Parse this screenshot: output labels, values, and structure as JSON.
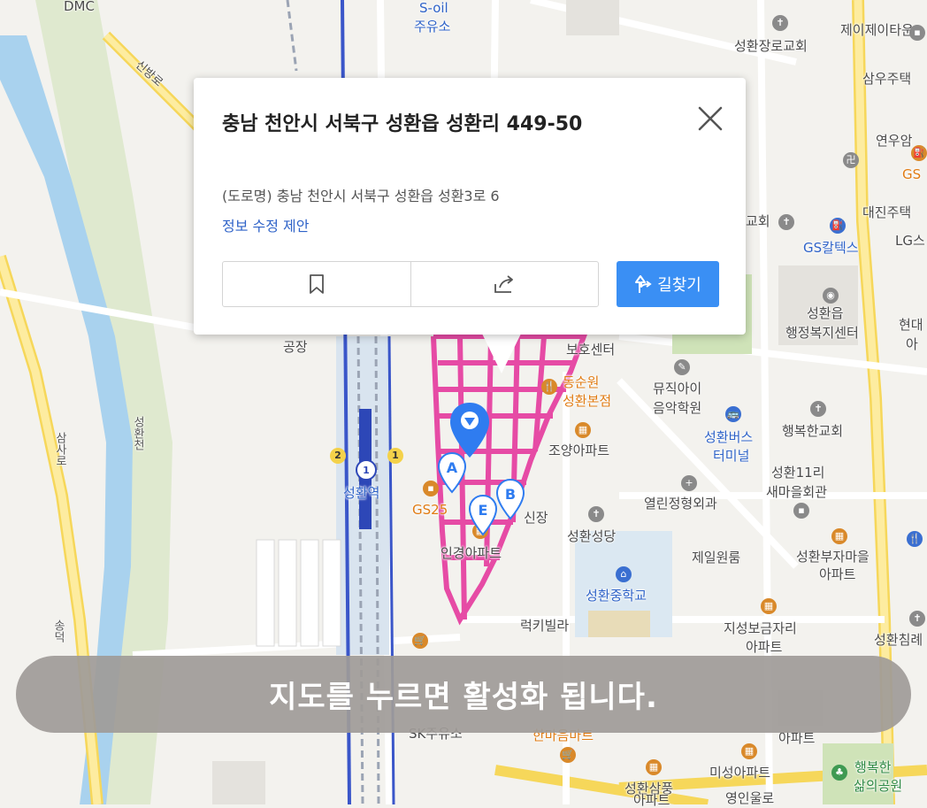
{
  "popup": {
    "title": "충남 천안시 서북구 성환읍 성환리 449-50",
    "road_address": "(도로명) 충남 천안시 서북구 성환읍 성환3로 6",
    "edit_link": "정보 수정 제안",
    "route_label": "길찾기"
  },
  "overlay": {
    "message": "지도를 누르면 활성화 됩니다."
  },
  "map": {
    "labels": [
      {
        "text": "DMC"
      },
      {
        "text": "S-oil"
      },
      {
        "text": "주유소"
      },
      {
        "text": "성환장로교회"
      },
      {
        "text": "제이제이타운"
      },
      {
        "text": "삼우주택"
      },
      {
        "text": "연우암"
      },
      {
        "text": "GS"
      },
      {
        "text": "교회"
      },
      {
        "text": "대진주택"
      },
      {
        "text": "GS칼텍스"
      },
      {
        "text": "LG스"
      },
      {
        "text": "성환읍"
      },
      {
        "text": "행정복지센터"
      },
      {
        "text": "현대"
      },
      {
        "text": "아"
      },
      {
        "text": "공장"
      },
      {
        "text": "보호센터"
      },
      {
        "text": "동순원"
      },
      {
        "text": "성환본점"
      },
      {
        "text": "뮤직아이"
      },
      {
        "text": "음악학원"
      },
      {
        "text": "성환버스"
      },
      {
        "text": "터미널"
      },
      {
        "text": "행복한교회"
      },
      {
        "text": "조양아파트"
      },
      {
        "text": "성환11리"
      },
      {
        "text": "새마을회관"
      },
      {
        "text": "성환역"
      },
      {
        "text": "GS25"
      },
      {
        "text": "신장"
      },
      {
        "text": "열린정형외과"
      },
      {
        "text": "성환성당"
      },
      {
        "text": "제일원룸"
      },
      {
        "text": "성환부자마을"
      },
      {
        "text": "아파트"
      },
      {
        "text": "인경아파트"
      },
      {
        "text": "성환중학교"
      },
      {
        "text": "럭키빌라"
      },
      {
        "text": "지성보금자리"
      },
      {
        "text": "아파트"
      },
      {
        "text": "성환침례"
      },
      {
        "text": "SK주유소"
      },
      {
        "text": "한마음마트"
      },
      {
        "text": "아파트"
      },
      {
        "text": "미성아파트"
      },
      {
        "text": "행복한"
      },
      {
        "text": "삶의공원"
      },
      {
        "text": "성환삼풍"
      },
      {
        "text": "아파트"
      },
      {
        "text": "영인울로"
      },
      {
        "text": "신방로"
      },
      {
        "text": "성환천"
      },
      {
        "text": "삼사로"
      },
      {
        "text": "송덕"
      }
    ],
    "station_badges": [
      "2",
      "1",
      "1"
    ],
    "markers": [
      "A",
      "B",
      "E"
    ],
    "colors": {
      "highlight_area": "#e64ba5",
      "route_button": "#3a8ff4",
      "water": "#a9d2ee",
      "rail": "#3a56c9"
    }
  }
}
